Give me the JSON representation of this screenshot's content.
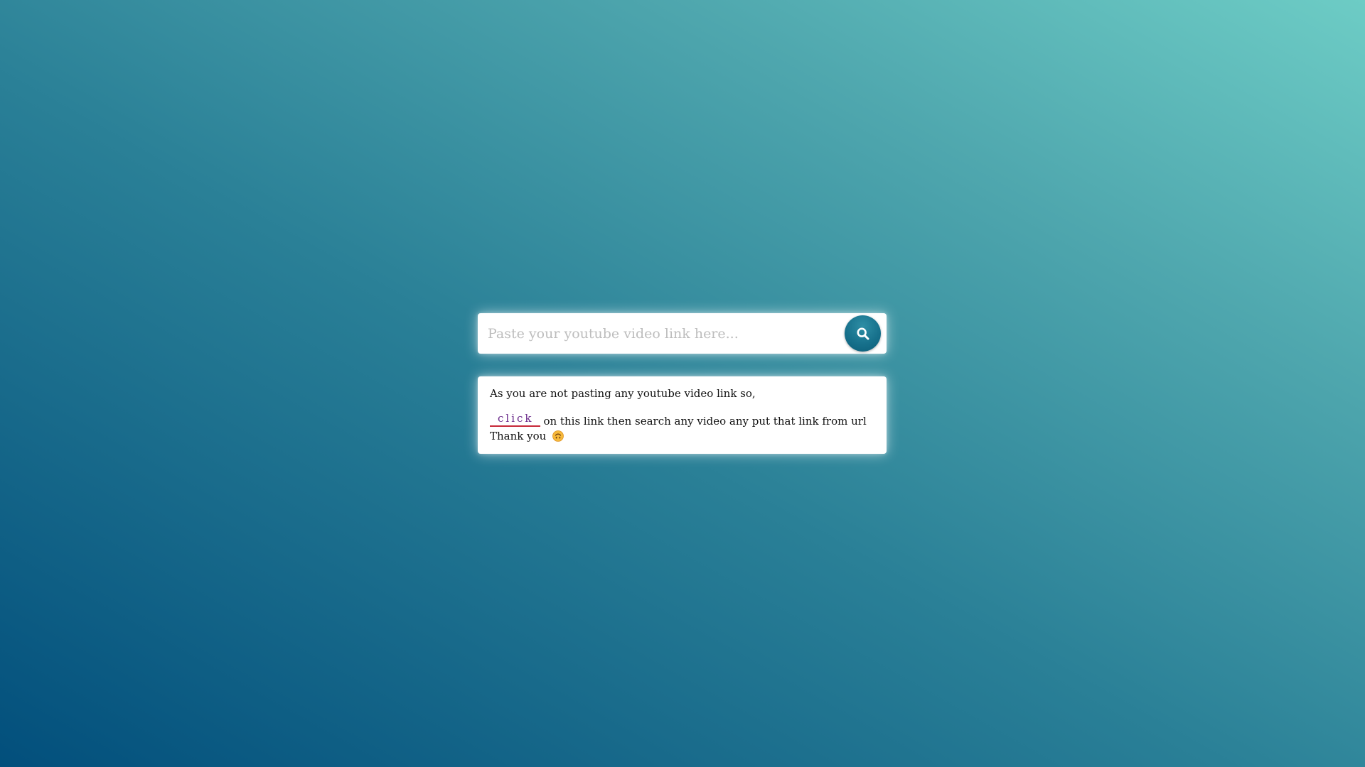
{
  "search": {
    "placeholder": "Paste your youtube video link here...",
    "value": "",
    "button_icon": "search-icon"
  },
  "message": {
    "line1": "As you are not pasting any youtube video link so,",
    "link_label": "click",
    "line2_rest": "on this link then search any video any put that link from url",
    "line3": "Thank you",
    "emoji_icon": "upside-down-face-icon"
  },
  "colors": {
    "background_top_right": "#6dccc5",
    "background_bottom_left": "#024f7c",
    "button": "#17718c",
    "link_text": "#6a2a8a",
    "link_underline": "#c62838"
  }
}
